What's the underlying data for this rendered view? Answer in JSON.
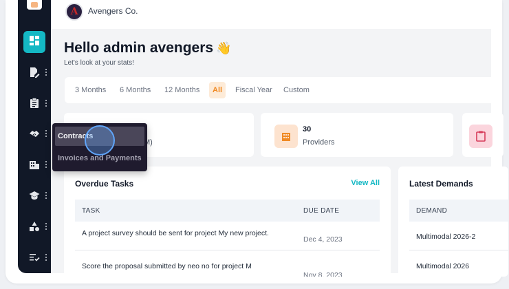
{
  "org": {
    "name": "Avengers Co.",
    "avatar_letter": "A"
  },
  "greeting": {
    "title": "Hello admin avengers",
    "emoji": "👋",
    "subtitle": "Let's look at your stats!"
  },
  "filters": [
    "3 Months",
    "6 Months",
    "12 Months",
    "All",
    "Fiscal Year",
    "Custom"
  ],
  "active_filter": "All",
  "stats": [
    {
      "value": "",
      "label": "M)",
      "icon": "hidden-icon"
    },
    {
      "value": "30",
      "label": "Providers",
      "icon": "building-icon"
    },
    {
      "value": "",
      "label": "",
      "icon": "clipboard-icon"
    }
  ],
  "sidebar": {
    "items": [
      {
        "icon": "dashboard-icon"
      },
      {
        "icon": "document-edit-icon"
      },
      {
        "icon": "clipboard-icon"
      },
      {
        "icon": "handshake-icon"
      },
      {
        "icon": "building-icon"
      },
      {
        "icon": "graduation-cap-icon"
      },
      {
        "icon": "shapes-icon"
      },
      {
        "icon": "checklist-icon"
      }
    ]
  },
  "popover": {
    "items": [
      "Contracts",
      "Invoices and Payments"
    ]
  },
  "overdue": {
    "title": "Overdue Tasks",
    "view_all": "View All",
    "columns": [
      "TASK",
      "DUE DATE"
    ],
    "rows": [
      {
        "task": "A project survey should be sent for project My new project.",
        "due": "Dec 4, 2023"
      },
      {
        "task": "Score the proposal submitted by neo no for project M",
        "due": "Nov 8, 2023"
      }
    ]
  },
  "demands": {
    "title": "Latest Demands",
    "columns": [
      "DEMAND"
    ],
    "rows": [
      "Multimodal 2026-2",
      "Multimodal 2026"
    ]
  },
  "colors": {
    "accent": "#14b8c4",
    "active_filter": "#f08a24",
    "sidebar": "#111827"
  }
}
